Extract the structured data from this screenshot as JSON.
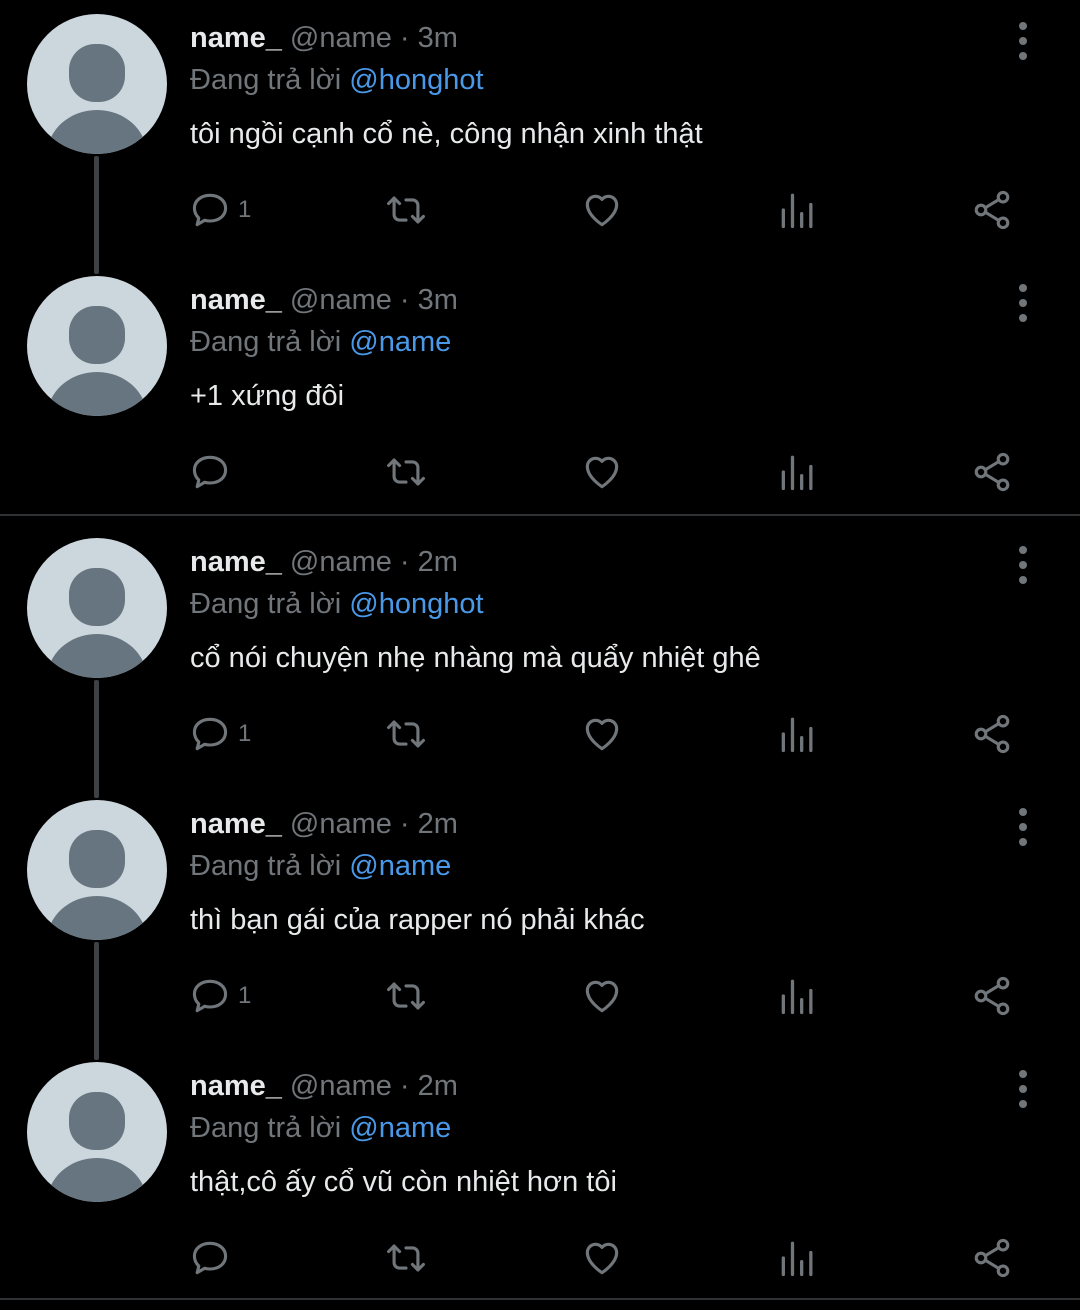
{
  "tweets": [
    {
      "name": "name_",
      "handle": "@name",
      "time": "3m",
      "reply_prefix": "Đang trả lời",
      "mention": "@honghot",
      "text": "tôi ngồi cạnh cổ nè, công nhận xinh thật",
      "replies": "1"
    },
    {
      "name": "name_",
      "handle": "@name",
      "time": "3m",
      "reply_prefix": "Đang trả lời",
      "mention": "@name",
      "text": "+1 xứng đôi",
      "replies": ""
    },
    {
      "name": "name_",
      "handle": "@name",
      "time": "2m",
      "reply_prefix": "Đang trả lời",
      "mention": "@honghot",
      "text": "cổ nói chuyện nhẹ nhàng mà quẩy nhiệt ghê",
      "replies": "1"
    },
    {
      "name": "name_",
      "handle": "@name",
      "time": "2m",
      "reply_prefix": "Đang trả lời",
      "mention": "@name",
      "text": "thì bạn gái của rapper nó phải khác",
      "replies": "1"
    },
    {
      "name": "name_",
      "handle": "@name",
      "time": "2m",
      "reply_prefix": "Đang trả lời",
      "mention": "@name",
      "text": "thật,cô ấy cổ vũ còn nhiệt hơn tôi",
      "replies": ""
    }
  ],
  "icons": {
    "reply": "reply-icon",
    "retweet": "retweet-icon",
    "like": "heart-icon",
    "views": "views-icon",
    "share": "share-icon",
    "more": "more-icon"
  },
  "colors": {
    "background": "#000000",
    "muted": "#71767b",
    "link": "#4a99e9",
    "text": "#e7e9ea"
  }
}
